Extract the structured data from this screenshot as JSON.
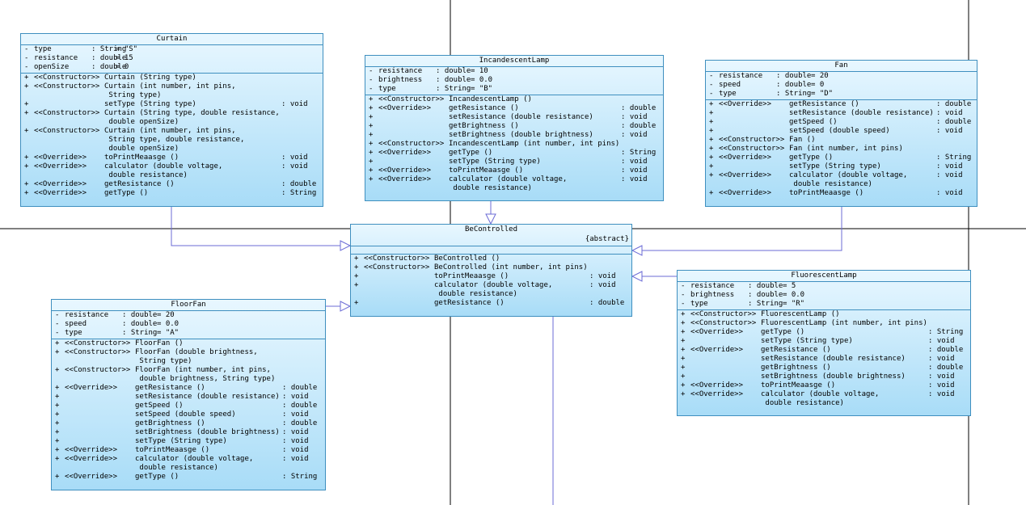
{
  "classes": {
    "curtain": {
      "name": "Curtain",
      "attributes": [
        {
          "vis": "-",
          "name": "type",
          "type": ": String",
          "val": "= \"S\""
        },
        {
          "vis": "-",
          "name": "resistance",
          "type": ": double",
          "val": "= 15"
        },
        {
          "vis": "-",
          "name": "openSize",
          "type": ": double",
          "val": "= 0"
        }
      ],
      "methods": [
        {
          "vis": "+",
          "st": "<<Constructor>>",
          "sig": "Curtain (String type)",
          "ret": ""
        },
        {
          "vis": "+",
          "st": "<<Constructor>>",
          "sig": "Curtain (int number, int pins,\n String type)",
          "ret": ""
        },
        {
          "vis": "+",
          "st": "",
          "sig": "setType (String type)",
          "ret": ": void"
        },
        {
          "vis": "+",
          "st": "<<Constructor>>",
          "sig": "Curtain (String type, double resistance,\n double openSize)",
          "ret": ""
        },
        {
          "vis": "+",
          "st": "<<Constructor>>",
          "sig": "Curtain (int number, int pins,\n String type, double resistance,\n double openSize)",
          "ret": ""
        },
        {
          "vis": "+",
          "st": "<<Override>>",
          "sig": "toPrintMeaasge ()",
          "ret": ": void"
        },
        {
          "vis": "+",
          "st": "<<Override>>",
          "sig": "calculator (double voltage,\n double resistance)",
          "ret": ": void"
        },
        {
          "vis": "+",
          "st": "<<Override>>",
          "sig": "getResistance ()",
          "ret": ": double"
        },
        {
          "vis": "+",
          "st": "<<Override>>",
          "sig": "getType ()",
          "ret": ": String"
        }
      ]
    },
    "incandescent": {
      "name": "IncandescentLamp",
      "attributes": [
        {
          "vis": "-",
          "name": "resistance",
          "type": ": double",
          "val": "= 10"
        },
        {
          "vis": "-",
          "name": "brightness",
          "type": ": double",
          "val": "= 0.0"
        },
        {
          "vis": "-",
          "name": "type",
          "type": ": String",
          "val": "= \"B\""
        }
      ],
      "methods": [
        {
          "vis": "+",
          "st": "<<Constructor>>",
          "sig": "IncandescentLamp ()",
          "ret": ""
        },
        {
          "vis": "+",
          "st": "<<Override>>",
          "sig": "getResistance ()",
          "ret": ": double"
        },
        {
          "vis": "+",
          "st": "",
          "sig": "setResistance (double resistance)",
          "ret": ": void"
        },
        {
          "vis": "+",
          "st": "",
          "sig": "getBrightness ()",
          "ret": ": double"
        },
        {
          "vis": "+",
          "st": "",
          "sig": "setBrightness (double brightness)",
          "ret": ": void"
        },
        {
          "vis": "+",
          "st": "<<Constructor>>",
          "sig": "IncandescentLamp (int number, int pins)",
          "ret": ""
        },
        {
          "vis": "+",
          "st": "<<Override>>",
          "sig": "getType ()",
          "ret": ": String"
        },
        {
          "vis": "+",
          "st": "",
          "sig": "setType (String type)",
          "ret": ": void"
        },
        {
          "vis": "+",
          "st": "<<Override>>",
          "sig": "toPrintMeaasge ()",
          "ret": ": void"
        },
        {
          "vis": "+",
          "st": "<<Override>>",
          "sig": "calculator (double voltage,\n double resistance)",
          "ret": ": void"
        }
      ]
    },
    "fan": {
      "name": "Fan",
      "attributes": [
        {
          "vis": "-",
          "name": "resistance",
          "type": ": double",
          "val": "= 20"
        },
        {
          "vis": "-",
          "name": "speed",
          "type": ": double",
          "val": "= 0"
        },
        {
          "vis": "-",
          "name": "type",
          "type": ": String",
          "val": "= \"D\""
        }
      ],
      "methods": [
        {
          "vis": "+",
          "st": "<<Override>>",
          "sig": "getResistance ()",
          "ret": ": double"
        },
        {
          "vis": "+",
          "st": "",
          "sig": "setResistance (double resistance)",
          "ret": ": void"
        },
        {
          "vis": "+",
          "st": "",
          "sig": "getSpeed ()",
          "ret": ": double"
        },
        {
          "vis": "+",
          "st": "",
          "sig": "setSpeed (double speed)",
          "ret": ": void"
        },
        {
          "vis": "+",
          "st": "<<Constructor>>",
          "sig": "Fan ()",
          "ret": ""
        },
        {
          "vis": "+",
          "st": "<<Constructor>>",
          "sig": "Fan (int number, int pins)",
          "ret": ""
        },
        {
          "vis": "+",
          "st": "<<Override>>",
          "sig": "getType ()",
          "ret": ": String"
        },
        {
          "vis": "+",
          "st": "",
          "sig": "setType (String type)",
          "ret": ": void"
        },
        {
          "vis": "+",
          "st": "<<Override>>",
          "sig": "calculator (double voltage,\n double resistance)",
          "ret": ": void"
        },
        {
          "vis": "+",
          "st": "<<Override>>",
          "sig": "toPrintMeaasge ()",
          "ret": ": void"
        }
      ]
    },
    "becontrolled": {
      "name": "BeControlled",
      "stereotype": "{abstract}",
      "attributes": [],
      "methods": [
        {
          "vis": "+",
          "st": "<<Constructor>>",
          "sig": "BeControlled ()",
          "ret": ""
        },
        {
          "vis": "+",
          "st": "<<Constructor>>",
          "sig": "BeControlled (int number, int pins)",
          "ret": ""
        },
        {
          "vis": "+",
          "st": "",
          "sig": "toPrintMeaasge ()",
          "ret": ": void"
        },
        {
          "vis": "+",
          "st": "",
          "sig": "calculator (double voltage,\n double resistance)",
          "ret": ": void"
        },
        {
          "vis": "+",
          "st": "",
          "sig": "getResistance ()",
          "ret": ": double"
        }
      ]
    },
    "floorfan": {
      "name": "FloorFan",
      "attributes": [
        {
          "vis": "-",
          "name": "resistance",
          "type": ": double",
          "val": "= 20"
        },
        {
          "vis": "-",
          "name": "speed",
          "type": ": double",
          "val": "= 0.0"
        },
        {
          "vis": "-",
          "name": "type",
          "type": ": String",
          "val": "= \"A\""
        }
      ],
      "methods": [
        {
          "vis": "+",
          "st": "<<Constructor>>",
          "sig": "FloorFan ()",
          "ret": ""
        },
        {
          "vis": "+",
          "st": "<<Constructor>>",
          "sig": "FloorFan (double brightness,\n String type)",
          "ret": ""
        },
        {
          "vis": "+",
          "st": "<<Constructor>>",
          "sig": "FloorFan (int number, int pins,\n double brightness, String type)",
          "ret": ""
        },
        {
          "vis": "+",
          "st": "<<Override>>",
          "sig": "getResistance ()",
          "ret": ": double"
        },
        {
          "vis": "+",
          "st": "",
          "sig": "setResistance (double resistance)",
          "ret": ": void"
        },
        {
          "vis": "+",
          "st": "",
          "sig": "getSpeed ()",
          "ret": ": double"
        },
        {
          "vis": "+",
          "st": "",
          "sig": "setSpeed (double speed)",
          "ret": ": void"
        },
        {
          "vis": "+",
          "st": "",
          "sig": "getBrightness ()",
          "ret": ": double"
        },
        {
          "vis": "+",
          "st": "",
          "sig": "setBrightness (double brightness)",
          "ret": ": void"
        },
        {
          "vis": "+",
          "st": "",
          "sig": "setType (String type)",
          "ret": ": void"
        },
        {
          "vis": "+",
          "st": "<<Override>>",
          "sig": "toPrintMeaasge ()",
          "ret": ": void"
        },
        {
          "vis": "+",
          "st": "<<Override>>",
          "sig": "calculator (double voltage,\n double resistance)",
          "ret": ": void"
        },
        {
          "vis": "+",
          "st": "<<Override>>",
          "sig": "getType ()",
          "ret": ": String"
        }
      ]
    },
    "fluorescent": {
      "name": "FluorescentLamp",
      "attributes": [
        {
          "vis": "-",
          "name": "resistance",
          "type": ": double",
          "val": "= 5"
        },
        {
          "vis": "-",
          "name": "brightness",
          "type": ": double",
          "val": "= 0.0"
        },
        {
          "vis": "-",
          "name": "type",
          "type": ": String",
          "val": "= \"R\""
        }
      ],
      "methods": [
        {
          "vis": "+",
          "st": "<<Constructor>>",
          "sig": "FluorescentLamp ()",
          "ret": ""
        },
        {
          "vis": "+",
          "st": "<<Constructor>>",
          "sig": "FluorescentLamp (int number, int pins)",
          "ret": ""
        },
        {
          "vis": "+",
          "st": "<<Override>>",
          "sig": "getType ()",
          "ret": ": String"
        },
        {
          "vis": "+",
          "st": "",
          "sig": "setType (String type)",
          "ret": ": void"
        },
        {
          "vis": "+",
          "st": "<<Override>>",
          "sig": "getResistance ()",
          "ret": ": double"
        },
        {
          "vis": "+",
          "st": "",
          "sig": "setResistance (double resistance)",
          "ret": ": void"
        },
        {
          "vis": "+",
          "st": "",
          "sig": "getBrightness ()",
          "ret": ": double"
        },
        {
          "vis": "+",
          "st": "",
          "sig": "setBrightness (double brightness)",
          "ret": ": void"
        },
        {
          "vis": "+",
          "st": "<<Override>>",
          "sig": "toPrintMeaasge ()",
          "ret": ": void"
        },
        {
          "vis": "+",
          "st": "<<Override>>",
          "sig": "calculator (double voltage,\n double resistance)",
          "ret": ": void"
        }
      ]
    }
  },
  "colors": {
    "border": "#3f8fbf",
    "connector": "#6b6bd6",
    "gridline": "#000000"
  }
}
